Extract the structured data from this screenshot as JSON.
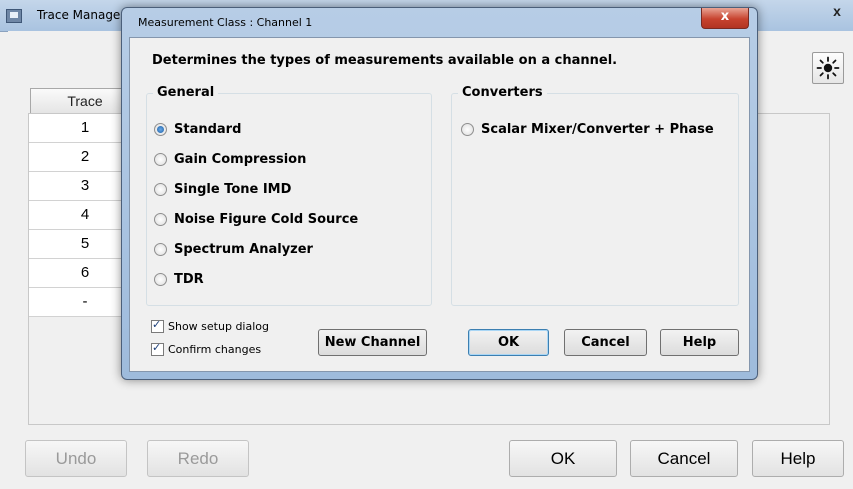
{
  "background_window": {
    "title": "Trace Manager",
    "close_label": "x",
    "table": {
      "column_header": "Trace",
      "rows": [
        "1",
        "2",
        "3",
        "4",
        "5",
        "6",
        "-"
      ]
    },
    "buttons": {
      "undo": "Undo",
      "redo": "Redo",
      "ok": "OK",
      "cancel": "Cancel",
      "help": "Help"
    },
    "toolbar_icon": "sun-icon"
  },
  "dialog": {
    "title": "Measurement Class : Channel 1",
    "close_label": "x",
    "description": "Determines the types of measurements available on a channel.",
    "general": {
      "legend": "General",
      "options": [
        {
          "label": "Standard",
          "selected": true
        },
        {
          "label": "Gain Compression",
          "selected": false
        },
        {
          "label": "Single Tone IMD",
          "selected": false
        },
        {
          "label": "Noise Figure Cold Source",
          "selected": false
        },
        {
          "label": "Spectrum Analyzer",
          "selected": false
        },
        {
          "label": "TDR",
          "selected": false
        }
      ]
    },
    "converters": {
      "legend": "Converters",
      "options": [
        {
          "label": "Scalar Mixer/Converter + Phase",
          "selected": false
        }
      ]
    },
    "checkboxes": {
      "show_setup": {
        "label": "Show setup dialog",
        "checked": true
      },
      "confirm_changes": {
        "label": "Confirm changes",
        "checked": true
      }
    },
    "buttons": {
      "new_channel": "New Channel",
      "ok": "OK",
      "cancel": "Cancel",
      "help": "Help"
    }
  },
  "colors": {
    "titlebar": "#a9c3e0",
    "dialog_close": "#c7432f",
    "radio_selected": "#1a5ea6",
    "window_bg": "#f0f0f0"
  }
}
